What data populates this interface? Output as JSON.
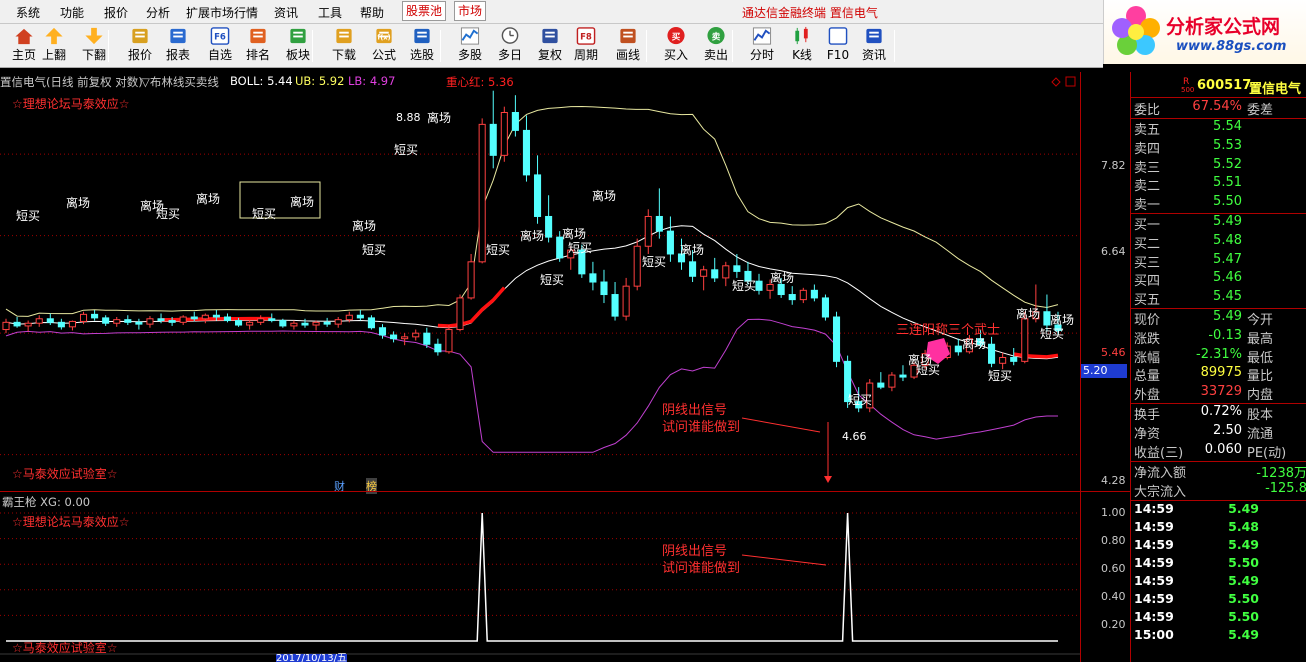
{
  "menu": [
    "系统",
    "功能",
    "报价",
    "分析",
    "扩展市场行情",
    "资讯",
    "工具",
    "帮助"
  ],
  "menu_boxed": [
    "股票池",
    "市场"
  ],
  "brand_text": "通达信金融终端  置信电气",
  "logo": {
    "text": "分析家公式网",
    "url": "www.88gs.com"
  },
  "toolbar": [
    {
      "label": "主页",
      "icon": "home-icon"
    },
    {
      "label": "上翻",
      "icon": "up-arrow-icon"
    },
    {
      "label": "下翻",
      "icon": "down-arrow-icon"
    },
    {
      "label": "报价",
      "icon": "quote-icon"
    },
    {
      "label": "报表",
      "icon": "report-icon"
    },
    {
      "label": "自选",
      "icon": "f6-key-icon"
    },
    {
      "label": "排名",
      "icon": "ranking-icon"
    },
    {
      "label": "板块",
      "icon": "sector-icon"
    },
    {
      "label": "下载",
      "icon": "download-icon"
    },
    {
      "label": "公式",
      "icon": "formula-icon"
    },
    {
      "label": "选股",
      "icon": "stock-picker-icon"
    },
    {
      "label": "多股",
      "icon": "multi-stock-icon"
    },
    {
      "label": "多日",
      "icon": "multi-day-icon"
    },
    {
      "label": "复权",
      "icon": "adjust-icon"
    },
    {
      "label": "周期",
      "icon": "f8-key-icon"
    },
    {
      "label": "画线",
      "icon": "draw-line-icon"
    },
    {
      "label": "买入",
      "icon": "buy-icon"
    },
    {
      "label": "卖出",
      "icon": "sell-icon"
    },
    {
      "label": "分时",
      "icon": "intraday-icon"
    },
    {
      "label": "K线",
      "icon": "candlestick-icon"
    },
    {
      "label": "F10",
      "icon": "f10-icon"
    },
    {
      "label": "资讯",
      "icon": "news-icon"
    }
  ],
  "toolbar_badges": {
    "f6": "F6",
    "f8": "F8",
    "fx": "f(x)",
    "buy": "买",
    "sell": "卖"
  },
  "chart_header": {
    "title": "置信电气(日线 前复权 对数)",
    "indicator": "▽布林线买卖线",
    "boll": "BOLL: 5.44",
    "ub": "UB: 5.92",
    "lb": "LB: 4.97",
    "center_label": "重心红: 5.36"
  },
  "labels": {
    "forum": "☆理想论坛马泰效应☆",
    "lab": "☆马泰效应试验室☆",
    "cai": "财",
    "bang": "榜",
    "signal_note": [
      "阴线出信号",
      "试问谁能做到"
    ],
    "pattern_note": "三连阳称三个武士",
    "high_price": "8.88",
    "low_price": "4.66",
    "sub_title": "霸王枪  XG: 0.00",
    "bottom_date": "2017/10/13/五"
  },
  "tags": {
    "leave": "离场",
    "short_buy": "短买"
  },
  "price_axis": [
    {
      "v": "7.82",
      "red": false
    },
    {
      "v": "6.64",
      "red": false
    },
    {
      "v": "5.46",
      "red": true
    },
    {
      "v": "4.28",
      "red": false
    }
  ],
  "current_price_label": "5.20",
  "sub_axis": [
    "1.00",
    "0.80",
    "0.60",
    "0.40",
    "0.20"
  ],
  "panel": {
    "code": "600517",
    "name": "置信电气",
    "r_tag": "R",
    "r_num": "500",
    "weibi": {
      "label": "委比",
      "value": "67.54%",
      "label2": "委差"
    },
    "asks": [
      {
        "label": "卖五",
        "price": "5.54"
      },
      {
        "label": "卖四",
        "price": "5.53"
      },
      {
        "label": "卖三",
        "price": "5.52"
      },
      {
        "label": "卖二",
        "price": "5.51"
      },
      {
        "label": "卖一",
        "price": "5.50"
      }
    ],
    "bids": [
      {
        "label": "买一",
        "price": "5.49"
      },
      {
        "label": "买二",
        "price": "5.48"
      },
      {
        "label": "买三",
        "price": "5.47"
      },
      {
        "label": "买四",
        "price": "5.46"
      },
      {
        "label": "买五",
        "price": "5.45"
      }
    ],
    "quote": [
      {
        "label": "现价",
        "value": "5.49",
        "color": "g",
        "label2": "今开"
      },
      {
        "label": "涨跌",
        "value": "-0.13",
        "color": "g",
        "label2": "最高"
      },
      {
        "label": "涨幅",
        "value": "-2.31%",
        "color": "g",
        "label2": "最低"
      },
      {
        "label": "总量",
        "value": "89975",
        "color": "y",
        "label2": "量比"
      },
      {
        "label": "外盘",
        "value": "33729",
        "color": "r",
        "label2": "内盘"
      }
    ],
    "fund": [
      {
        "label": "换手",
        "value": "0.72%",
        "label2": "股本"
      },
      {
        "label": "净资",
        "value": "2.50",
        "label2": "流通"
      },
      {
        "label": "收益(三)",
        "value": "0.060",
        "label2": "PE(动)"
      }
    ],
    "flows": [
      {
        "label": "净流入额",
        "value": "-1238万"
      },
      {
        "label": "大宗流入",
        "value": "-125.8"
      }
    ],
    "ticks": [
      {
        "time": "14:59",
        "price": "5.49"
      },
      {
        "time": "14:59",
        "price": "5.48"
      },
      {
        "time": "14:59",
        "price": "5.49"
      },
      {
        "time": "14:59",
        "price": "5.50"
      },
      {
        "time": "14:59",
        "price": "5.49"
      },
      {
        "time": "14:59",
        "price": "5.50"
      },
      {
        "time": "14:59",
        "price": "5.50"
      },
      {
        "time": "15:00",
        "price": "5.49"
      }
    ]
  },
  "colors": {
    "up": "#ff4040",
    "down": "#54ffff",
    "upper_band": "#e8e8a0",
    "lower_band": "#c040d0",
    "mid_band": "#ffffff",
    "center_red": "#ff1010",
    "grid": "#a00000",
    "signal": "#ffffff"
  },
  "candles_note": "",
  "chart_data": {
    "type": "candlestick",
    "ylim": [
      4.28,
      8.88
    ],
    "candles": [
      [
        5.5,
        5.62,
        5.46,
        5.58
      ],
      [
        5.58,
        5.64,
        5.52,
        5.54
      ],
      [
        5.54,
        5.6,
        5.48,
        5.57
      ],
      [
        5.57,
        5.66,
        5.53,
        5.62
      ],
      [
        5.62,
        5.68,
        5.55,
        5.58
      ],
      [
        5.58,
        5.62,
        5.5,
        5.53
      ],
      [
        5.53,
        5.6,
        5.49,
        5.59
      ],
      [
        5.59,
        5.7,
        5.56,
        5.67
      ],
      [
        5.67,
        5.72,
        5.6,
        5.63
      ],
      [
        5.63,
        5.66,
        5.54,
        5.57
      ],
      [
        5.57,
        5.64,
        5.53,
        5.61
      ],
      [
        5.61,
        5.66,
        5.55,
        5.58
      ],
      [
        5.58,
        5.62,
        5.5,
        5.56
      ],
      [
        5.56,
        5.65,
        5.52,
        5.62
      ],
      [
        5.62,
        5.68,
        5.57,
        5.6
      ],
      [
        5.6,
        5.64,
        5.54,
        5.58
      ],
      [
        5.58,
        5.66,
        5.55,
        5.64
      ],
      [
        5.64,
        5.7,
        5.59,
        5.62
      ],
      [
        5.62,
        5.68,
        5.57,
        5.66
      ],
      [
        5.66,
        5.72,
        5.6,
        5.64
      ],
      [
        5.64,
        5.68,
        5.58,
        5.6
      ],
      [
        5.6,
        5.63,
        5.53,
        5.55
      ],
      [
        5.55,
        5.6,
        5.5,
        5.58
      ],
      [
        5.58,
        5.66,
        5.55,
        5.62
      ],
      [
        5.62,
        5.68,
        5.58,
        5.6
      ],
      [
        5.6,
        5.62,
        5.52,
        5.54
      ],
      [
        5.54,
        5.6,
        5.5,
        5.57
      ],
      [
        5.57,
        5.62,
        5.52,
        5.55
      ],
      [
        5.55,
        5.6,
        5.49,
        5.58
      ],
      [
        5.58,
        5.63,
        5.53,
        5.56
      ],
      [
        5.56,
        5.64,
        5.52,
        5.61
      ],
      [
        5.61,
        5.7,
        5.58,
        5.66
      ],
      [
        5.66,
        5.72,
        5.6,
        5.63
      ],
      [
        5.63,
        5.66,
        5.5,
        5.52
      ],
      [
        5.52,
        5.56,
        5.4,
        5.44
      ],
      [
        5.44,
        5.48,
        5.36,
        5.4
      ],
      [
        5.4,
        5.46,
        5.33,
        5.42
      ],
      [
        5.42,
        5.5,
        5.38,
        5.46
      ],
      [
        5.46,
        5.52,
        5.3,
        5.34
      ],
      [
        5.34,
        5.4,
        5.22,
        5.26
      ],
      [
        5.26,
        5.55,
        5.24,
        5.5
      ],
      [
        5.5,
        5.9,
        5.48,
        5.86
      ],
      [
        5.86,
        6.4,
        5.84,
        6.3
      ],
      [
        6.3,
        8.4,
        6.28,
        8.3
      ],
      [
        8.3,
        8.88,
        7.6,
        7.8
      ],
      [
        7.8,
        8.6,
        7.7,
        8.5
      ],
      [
        8.5,
        8.8,
        8.1,
        8.2
      ],
      [
        8.2,
        8.45,
        7.4,
        7.5
      ],
      [
        7.5,
        7.8,
        6.8,
        6.9
      ],
      [
        6.9,
        7.2,
        6.55,
        6.62
      ],
      [
        6.62,
        6.7,
        6.3,
        6.35
      ],
      [
        6.35,
        6.5,
        6.2,
        6.45
      ],
      [
        6.45,
        6.52,
        6.1,
        6.15
      ],
      [
        6.15,
        6.3,
        5.95,
        6.05
      ],
      [
        6.05,
        6.2,
        5.8,
        5.9
      ],
      [
        5.9,
        6.05,
        5.6,
        5.65
      ],
      [
        5.65,
        6.1,
        5.6,
        6.0
      ],
      [
        6.0,
        6.6,
        5.95,
        6.5
      ],
      [
        6.5,
        7.0,
        6.4,
        6.9
      ],
      [
        6.9,
        7.3,
        6.6,
        6.7
      ],
      [
        6.7,
        6.9,
        6.3,
        6.4
      ],
      [
        6.4,
        6.6,
        6.2,
        6.3
      ],
      [
        6.3,
        6.45,
        6.05,
        6.12
      ],
      [
        6.12,
        6.25,
        5.95,
        6.2
      ],
      [
        6.2,
        6.35,
        6.05,
        6.1
      ],
      [
        6.1,
        6.3,
        6.0,
        6.25
      ],
      [
        6.25,
        6.4,
        6.1,
        6.18
      ],
      [
        6.18,
        6.3,
        6.02,
        6.06
      ],
      [
        6.06,
        6.15,
        5.9,
        5.95
      ],
      [
        5.95,
        6.08,
        5.85,
        6.02
      ],
      [
        6.02,
        6.1,
        5.86,
        5.9
      ],
      [
        5.9,
        6.0,
        5.78,
        5.84
      ],
      [
        5.84,
        5.98,
        5.8,
        5.95
      ],
      [
        5.95,
        6.02,
        5.82,
        5.86
      ],
      [
        5.86,
        5.9,
        5.6,
        5.64
      ],
      [
        5.64,
        5.7,
        5.1,
        5.16
      ],
      [
        5.16,
        5.22,
        4.7,
        4.76
      ],
      [
        4.76,
        4.9,
        4.66,
        4.7
      ],
      [
        4.7,
        4.98,
        4.66,
        4.94
      ],
      [
        4.94,
        5.05,
        4.88,
        4.9
      ],
      [
        4.9,
        5.05,
        4.86,
        5.02
      ],
      [
        5.02,
        5.12,
        4.96,
        5.0
      ],
      [
        5.0,
        5.15,
        4.98,
        5.12
      ],
      [
        5.12,
        5.28,
        5.08,
        5.24
      ],
      [
        5.24,
        5.3,
        5.15,
        5.2
      ],
      [
        5.2,
        5.36,
        5.18,
        5.32
      ],
      [
        5.32,
        5.4,
        5.22,
        5.26
      ],
      [
        5.26,
        5.44,
        5.24,
        5.4
      ],
      [
        5.4,
        5.5,
        5.3,
        5.34
      ],
      [
        5.34,
        5.42,
        5.1,
        5.14
      ],
      [
        5.14,
        5.25,
        5.08,
        5.2
      ],
      [
        5.2,
        5.3,
        5.12,
        5.16
      ],
      [
        5.16,
        5.7,
        5.14,
        5.62
      ],
      [
        5.62,
        6.02,
        5.58,
        5.7
      ],
      [
        5.7,
        5.9,
        5.48,
        5.55
      ],
      [
        5.55,
        5.7,
        5.45,
        5.49
      ]
    ],
    "signals": [
      0,
      0,
      0,
      0,
      0,
      0,
      0,
      0,
      0,
      0,
      0,
      0,
      0,
      0,
      0,
      0,
      0,
      0,
      0,
      0,
      0,
      0,
      0,
      0,
      0,
      0,
      0,
      0,
      0,
      0,
      0,
      0,
      0,
      0,
      0,
      0,
      0,
      0,
      0,
      0,
      0,
      0,
      0,
      0,
      0,
      0,
      0,
      0,
      0,
      0,
      0,
      0,
      0,
      0,
      0,
      0,
      0,
      0,
      0,
      0,
      0,
      0,
      0,
      0,
      0,
      0,
      0,
      0,
      0,
      0,
      0,
      0,
      0,
      0,
      0,
      0,
      0,
      0,
      0,
      0,
      0,
      0,
      0,
      0,
      0,
      0,
      0,
      0,
      0,
      0,
      0,
      0,
      0,
      0,
      0,
      0
    ]
  }
}
